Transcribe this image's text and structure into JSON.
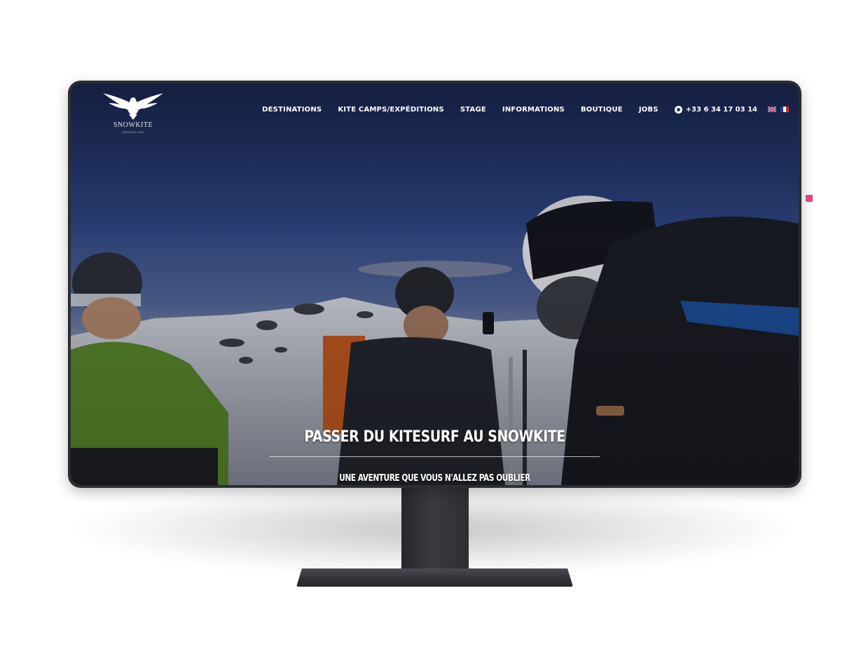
{
  "site": {
    "logo": {
      "name": "SNOWKITE",
      "tagline": "SENSATION"
    },
    "nav": {
      "items": [
        {
          "label": "DESTINATIONS",
          "name": "nav-destinations"
        },
        {
          "label": "KITE CAMPS/EXPÉDITIONS",
          "name": "nav-kite-camps"
        },
        {
          "label": "STAGE",
          "name": "nav-stage"
        },
        {
          "label": "INFORMATIONS",
          "name": "nav-informations"
        },
        {
          "label": "BOUTIQUE",
          "name": "nav-boutique"
        },
        {
          "label": "JOBS",
          "name": "nav-jobs"
        }
      ],
      "phone": "+33 6 34 17 03 14",
      "phone_icon": "whatsapp-icon",
      "languages": [
        "en-flag-icon",
        "fr-flag-icon"
      ]
    },
    "hero": {
      "title": "PASSER DU KITESURF AU SNOWKITE",
      "subtitle": "UNE AVENTURE QUE VOUS N'ALLEZ PAS OUBLIER"
    }
  },
  "colors": {
    "monitor_frame": "#2b2d31",
    "accent_marker": "#e0457b",
    "text": "#ffffff"
  }
}
